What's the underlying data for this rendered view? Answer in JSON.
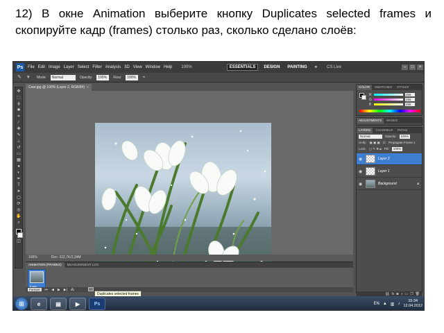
{
  "caption": "12) В окне Animation выберите кнопку Duplicates selected frames и скопируйте кадр (frames) столько раз, сколько сделано слоёв:",
  "app": {
    "logo": "Ps",
    "menu": [
      "File",
      "Edit",
      "Image",
      "Layer",
      "Select",
      "Filter",
      "Analysis",
      "3D",
      "View",
      "Window",
      "Help"
    ],
    "zoom": "100%",
    "workspaces": [
      "ESSENTIALS",
      "DESIGN",
      "PAINTING"
    ],
    "workspaces_more": "»",
    "cs_live": "CS Live"
  },
  "options": {
    "mode_label": "Mode:",
    "mode_value": "Normal",
    "opacity_label": "Opacity:",
    "opacity_value": "100%",
    "flow_label": "Flow:",
    "flow_value": "100%"
  },
  "document": {
    "tab": "Снег.jpg @ 100% (Layer 2, RGB/8#)",
    "close": "×",
    "status_zoom": "100%",
    "status_doc": "Doc: 322,7K/2,34M"
  },
  "color_panel": {
    "tabs": [
      "COLOR",
      "SWATCHES",
      "STYLES"
    ],
    "channels": [
      {
        "name": "R",
        "value": "255",
        "color": "#e03030"
      },
      {
        "name": "G",
        "value": "255",
        "color": "#30c040"
      },
      {
        "name": "B",
        "value": "255",
        "color": "#3060e0"
      }
    ]
  },
  "adjustments_panel": {
    "tabs": [
      "ADJUSTMENTS",
      "MASKS"
    ]
  },
  "layers_panel": {
    "tabs": [
      "LAYERS",
      "CHANNELS",
      "PATHS"
    ],
    "blend_mode": "Normal",
    "opacity_label": "Opacity:",
    "opacity_value": "100%",
    "unify_label": "Unify:",
    "propagate_label": "Propagate Frame 1",
    "lock_label": "Lock:",
    "fill_label": "Fill:",
    "fill_value": "100%",
    "layers": [
      {
        "name": "Layer 2",
        "selected": true
      },
      {
        "name": "Layer 1",
        "selected": false
      },
      {
        "name": "Background",
        "selected": false
      }
    ]
  },
  "animation_panel": {
    "tabs": [
      "ANIMATION (FRAMES)",
      "MEASUREMENT LOG"
    ],
    "frame_number": "1",
    "frame_time": "0 sec.",
    "loop": "Forever",
    "tooltip": "Duplicates selected frames"
  },
  "taskbar": {
    "start": "⊞",
    "apps": [
      {
        "name": "ie",
        "glyph": "e"
      },
      {
        "name": "explorer",
        "glyph": "▤"
      },
      {
        "name": "media",
        "glyph": "▶"
      },
      {
        "name": "photoshop",
        "glyph": "Ps"
      }
    ],
    "lang": "EN",
    "time": "15:34",
    "date": "12.04.2012"
  }
}
